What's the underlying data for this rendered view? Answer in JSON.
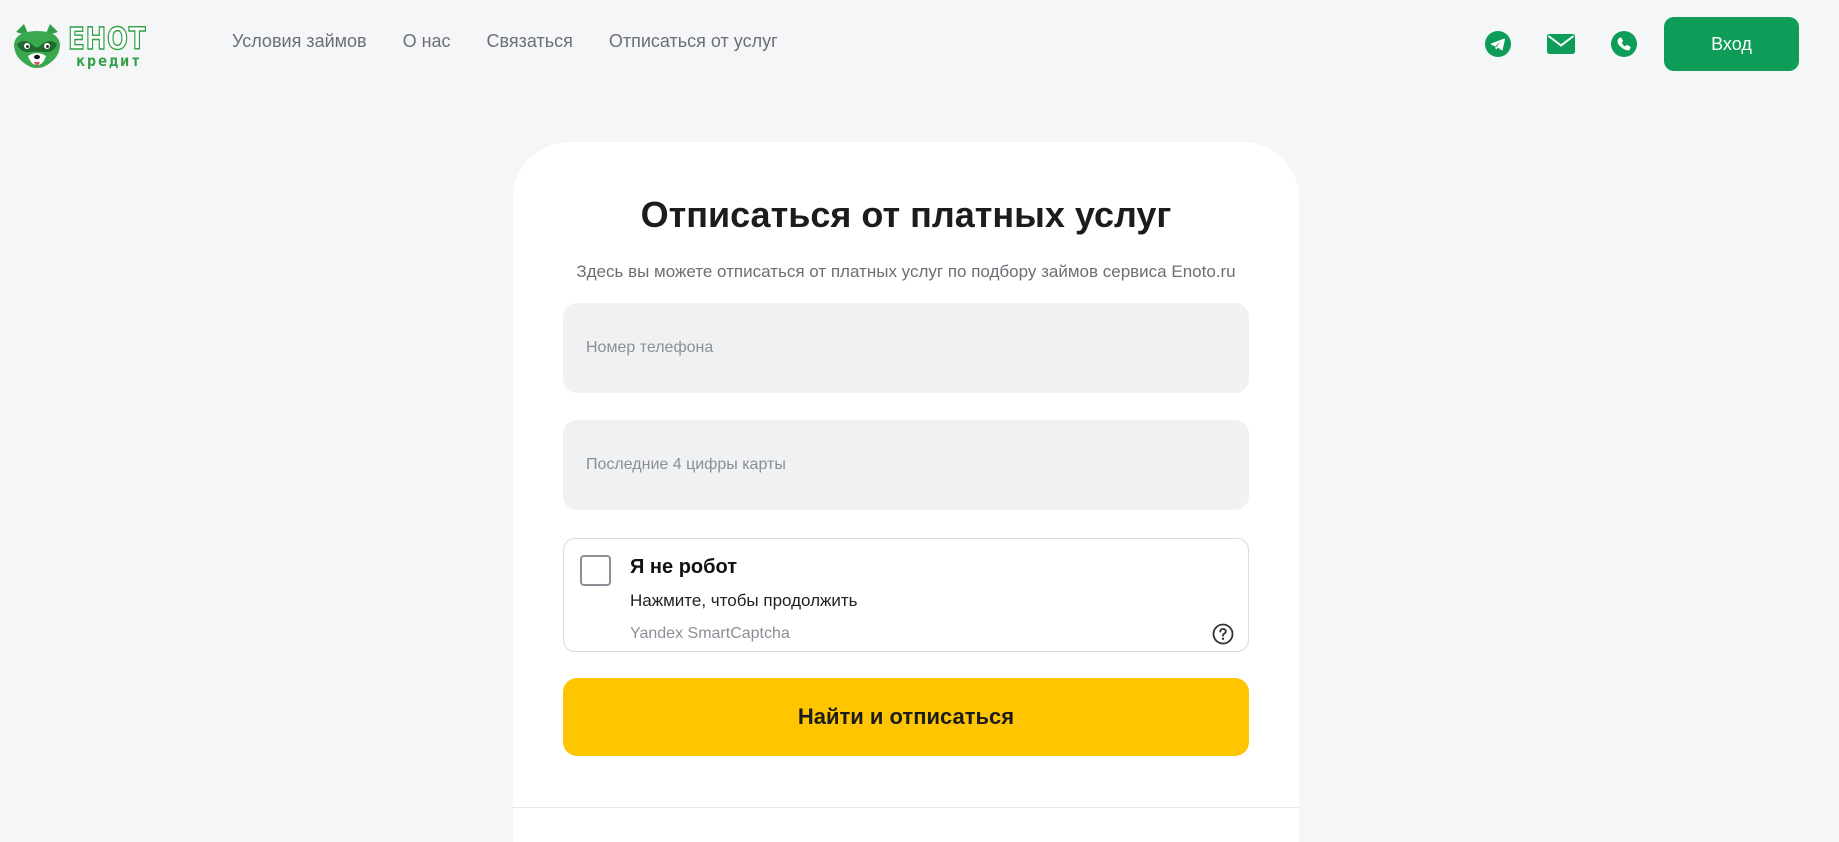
{
  "header": {
    "logo": {
      "word": "ЕНОТ",
      "sub": "кредит"
    },
    "nav": [
      {
        "label": "Условия займов"
      },
      {
        "label": "О нас"
      },
      {
        "label": "Связаться"
      },
      {
        "label": "Отписаться от услуг"
      }
    ],
    "contacts": {
      "icons": [
        "telegram-icon",
        "mail-icon",
        "phone-icon"
      ],
      "color": "#0d9d58"
    },
    "login_label": "Вход"
  },
  "form": {
    "title": "Отписаться от платных услуг",
    "subtitle": "Здесь вы можете отписаться от платных услуг по подбору займов сервиса Enoto.ru",
    "phone": {
      "placeholder": "Номер телефона",
      "value": ""
    },
    "card_digits": {
      "placeholder": "Последние 4 цифры карты",
      "value": ""
    },
    "captcha": {
      "label": "Я не робот",
      "hint": "Нажмите, чтобы продолжить",
      "brand": "Yandex SmartCaptcha",
      "checked": false
    },
    "submit_label": "Найти и отписаться"
  },
  "colors": {
    "accent": "#0d9d58",
    "submit": "#ffc500",
    "background": "#f5f6f8",
    "logo_green": "#2f9e44"
  }
}
